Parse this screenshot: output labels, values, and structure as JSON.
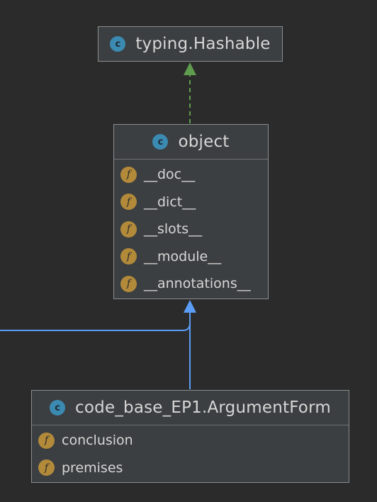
{
  "diagram": {
    "colors": {
      "background": "#2b2b2b",
      "node_fill": "#3c3f41",
      "node_border": "#8a8d8f",
      "class_icon": "#3b8ab2",
      "field_icon": "#b28a3a",
      "inheritance_edge": "#5b9cf5",
      "implements_edge": "#5f9c4e"
    },
    "icons": {
      "class_letter": "c",
      "field_letter": "f"
    },
    "nodes": {
      "hashable": {
        "title": "typing.Hashable",
        "fields": []
      },
      "object": {
        "title": "object",
        "fields": [
          "__doc__",
          "__dict__",
          "__slots__",
          "__module__",
          "__annotations__"
        ]
      },
      "argument_form": {
        "title": "code_base_EP1.ArgumentForm",
        "fields": [
          "conclusion",
          "premises"
        ]
      }
    },
    "edges": [
      {
        "from": "object",
        "to": "hashable",
        "style": "dashed",
        "color": "#5f9c4e"
      },
      {
        "from": "argument_form",
        "to": "object",
        "style": "solid",
        "color": "#5b9cf5"
      },
      {
        "from": "offscreen-left",
        "to": "object",
        "style": "solid",
        "color": "#5b9cf5"
      }
    ]
  }
}
